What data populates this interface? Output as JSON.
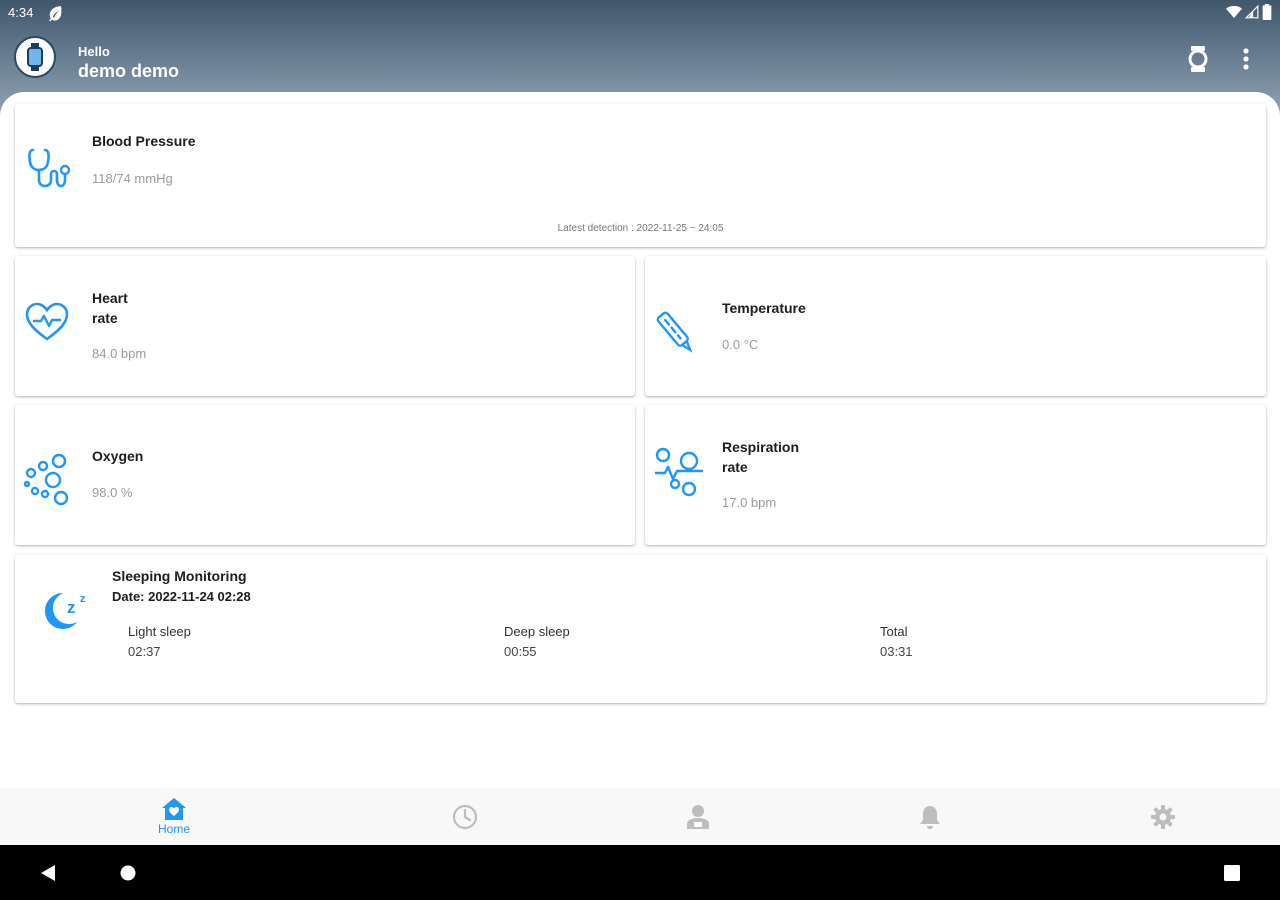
{
  "status_bar": {
    "time": "4:34"
  },
  "header": {
    "greeting": "Hello",
    "user_name": "demo demo"
  },
  "cards": {
    "blood_pressure": {
      "title": "Blood Pressure",
      "value": "118/74 mmHg",
      "latest": "Latest detection : 2022-11-25 ~ 24:05"
    },
    "heart_rate": {
      "title_line1": "Heart",
      "title_line2": "rate",
      "value": "84.0 bpm"
    },
    "temperature": {
      "title": "Temperature",
      "value": "0.0 °C"
    },
    "oxygen": {
      "title": "Oxygen",
      "value": "98.0 %"
    },
    "respiration": {
      "title_line1": "Respiration",
      "title_line2": "rate",
      "value": "17.0 bpm"
    }
  },
  "sleep": {
    "title": "Sleeping Monitoring",
    "date": "Date: 2022-11-24 02:28",
    "light_label": "Light sleep",
    "light_value": "02:37",
    "deep_label": "Deep sleep",
    "deep_value": "00:55",
    "total_label": "Total",
    "total_value": "03:31"
  },
  "bottom_nav": {
    "home_label": "Home"
  },
  "icons": {
    "accent": "#2196f3",
    "inactive": "#bdbdbd",
    "names": [
      "stethoscope-icon",
      "heart-pulse-icon",
      "thermometer-icon",
      "oxygen-bubbles-icon",
      "respiration-icon",
      "sleep-moon-icon",
      "home-icon",
      "history-clock-icon",
      "profile-icon",
      "notifications-bell-icon",
      "settings-gear-icon",
      "smartwatch-icon",
      "more-vert-icon"
    ]
  }
}
